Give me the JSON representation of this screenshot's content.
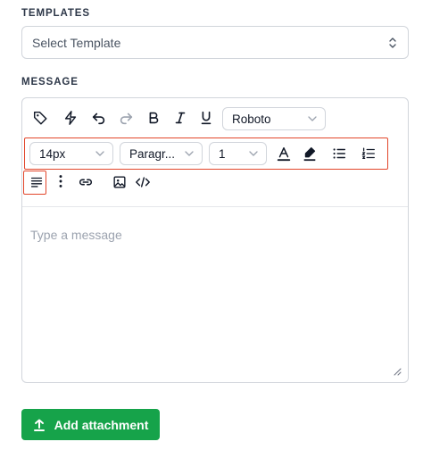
{
  "templates": {
    "label": "TEMPLATES",
    "select_value": "Select Template"
  },
  "message": {
    "label": "MESSAGE",
    "placeholder": "Type a message"
  },
  "toolbar": {
    "icons": [
      "tag-icon",
      "lightning-icon",
      "undo-icon",
      "redo-icon",
      "bold-icon",
      "italic-icon",
      "underline-icon"
    ],
    "font_family": "Roboto",
    "font_size": "14px",
    "block_format": "Paragr...",
    "line_height": "1",
    "more_icons": [
      "text-color-icon",
      "highlight-icon",
      "bullet-list-icon",
      "numbered-list-icon",
      "align-left-icon",
      "more-vertical-icon",
      "link-icon",
      "image-icon",
      "code-icon"
    ],
    "highlight_color": "#e2462b"
  },
  "attachment": {
    "button_label": "Add attachment",
    "color": "#16a34a"
  }
}
